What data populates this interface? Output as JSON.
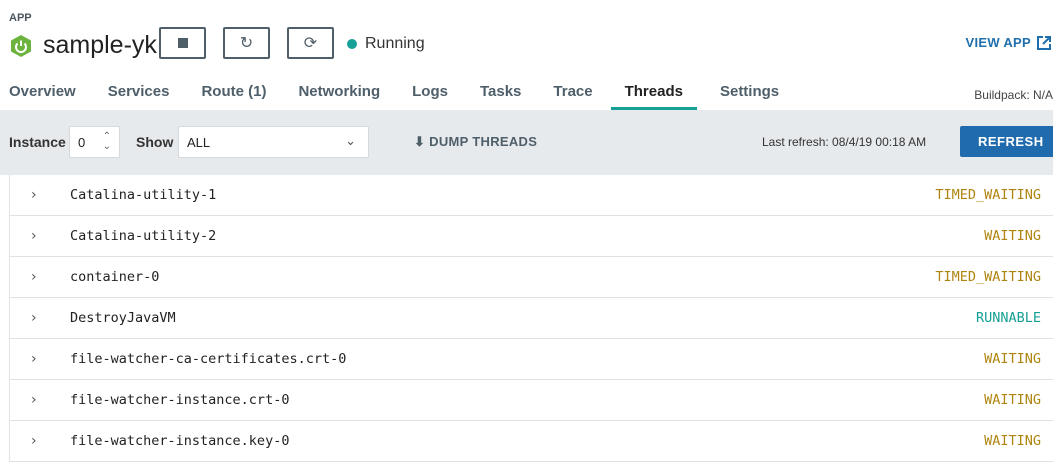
{
  "header": {
    "app_label": "APP",
    "app_name": "sample-yk",
    "status": "Running",
    "view_app": "VIEW APP",
    "buildpack": "Buildpack: N/A"
  },
  "colors": {
    "running": "#17a095",
    "waiting": "#b0850f",
    "accent": "#1f6bad"
  },
  "tabs": [
    "Overview",
    "Services",
    "Route (1)",
    "Networking",
    "Logs",
    "Tasks",
    "Trace",
    "Threads",
    "Settings"
  ],
  "active_tab": "Threads",
  "toolbar": {
    "instance_label": "Instance",
    "instance_value": "0",
    "show_label": "Show",
    "show_value": "ALL",
    "dump": "DUMP THREADS",
    "last_refresh": "Last refresh: 08/4/19 00:18 AM",
    "refresh": "REFRESH"
  },
  "threads": [
    {
      "name": "Catalina-utility-1",
      "state": "TIMED_WAITING"
    },
    {
      "name": "Catalina-utility-2",
      "state": "WAITING"
    },
    {
      "name": "container-0",
      "state": "TIMED_WAITING"
    },
    {
      "name": "DestroyJavaVM",
      "state": "RUNNABLE"
    },
    {
      "name": "file-watcher-ca-certificates.crt-0",
      "state": "WAITING"
    },
    {
      "name": "file-watcher-instance.crt-0",
      "state": "WAITING"
    },
    {
      "name": "file-watcher-instance.key-0",
      "state": "WAITING"
    }
  ]
}
